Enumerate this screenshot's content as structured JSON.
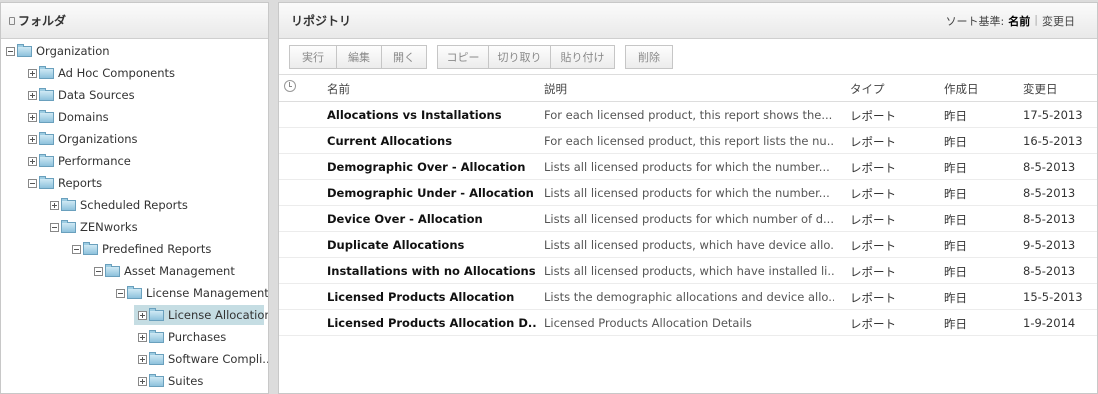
{
  "folder_panel": {
    "title": "フォルダ"
  },
  "tree": [
    {
      "label": "Organization",
      "toggle": "minus"
    },
    {
      "label": "Ad Hoc Components",
      "toggle": "plus"
    },
    {
      "label": "Data Sources",
      "toggle": "plus"
    },
    {
      "label": "Domains",
      "toggle": "plus"
    },
    {
      "label": "Organizations",
      "toggle": "plus"
    },
    {
      "label": "Performance",
      "toggle": "plus"
    },
    {
      "label": "Reports",
      "toggle": "minus"
    },
    {
      "label": "Scheduled Reports",
      "toggle": "plus"
    },
    {
      "label": "ZENworks",
      "toggle": "minus"
    },
    {
      "label": "Predefined Reports",
      "toggle": "minus"
    },
    {
      "label": "Asset Management",
      "toggle": "minus"
    },
    {
      "label": "License Management",
      "toggle": "minus"
    },
    {
      "label": "License Allocation",
      "toggle": "plus",
      "selected": true
    },
    {
      "label": "Purchases",
      "toggle": "plus"
    },
    {
      "label": "Software Compli...",
      "toggle": "plus"
    },
    {
      "label": "Suites",
      "toggle": "plus"
    }
  ],
  "repo_panel": {
    "title": "リポジトリ",
    "sort_label": "ソート基準:",
    "sort_name": "名前",
    "sort_date": "変更日"
  },
  "toolbar": {
    "run": "実行",
    "edit": "編集",
    "open": "開く",
    "copy": "コピー",
    "cut": "切り取り",
    "paste": "貼り付け",
    "delete": "削除"
  },
  "table": {
    "headers": {
      "name": "名前",
      "desc": "説明",
      "type": "タイプ",
      "created": "作成日",
      "modified": "変更日"
    },
    "rows": [
      {
        "name": "Allocations vs Installations",
        "desc": "For each licensed product, this report shows the...",
        "type": "レポート",
        "created": "昨日",
        "modified": "17-5-2013"
      },
      {
        "name": "Current Allocations",
        "desc": "For each licensed product, this report lists the nu...",
        "type": "レポート",
        "created": "昨日",
        "modified": "16-5-2013"
      },
      {
        "name": "Demographic Over - Allocation",
        "desc": "Lists all licensed products for which the number...",
        "type": "レポート",
        "created": "昨日",
        "modified": "8-5-2013"
      },
      {
        "name": "Demographic Under - Allocation",
        "desc": "Lists all licensed products for which the number...",
        "type": "レポート",
        "created": "昨日",
        "modified": "8-5-2013"
      },
      {
        "name": "Device Over - Allocation",
        "desc": "Lists all licensed products for which number of d...",
        "type": "レポート",
        "created": "昨日",
        "modified": "8-5-2013"
      },
      {
        "name": "Duplicate Allocations",
        "desc": "Lists all licensed products, which have device allo...",
        "type": "レポート",
        "created": "昨日",
        "modified": "9-5-2013"
      },
      {
        "name": "Installations with no Allocations",
        "desc": "Lists all licensed products, which have installed li...",
        "type": "レポート",
        "created": "昨日",
        "modified": "8-5-2013"
      },
      {
        "name": "Licensed Products Allocation",
        "desc": "Lists the demographic allocations and device allo...",
        "type": "レポート",
        "created": "昨日",
        "modified": "15-5-2013"
      },
      {
        "name": "Licensed Products Allocation D...",
        "desc": "Licensed Products Allocation Details",
        "type": "レポート",
        "created": "昨日",
        "modified": "1-9-2014"
      }
    ]
  }
}
